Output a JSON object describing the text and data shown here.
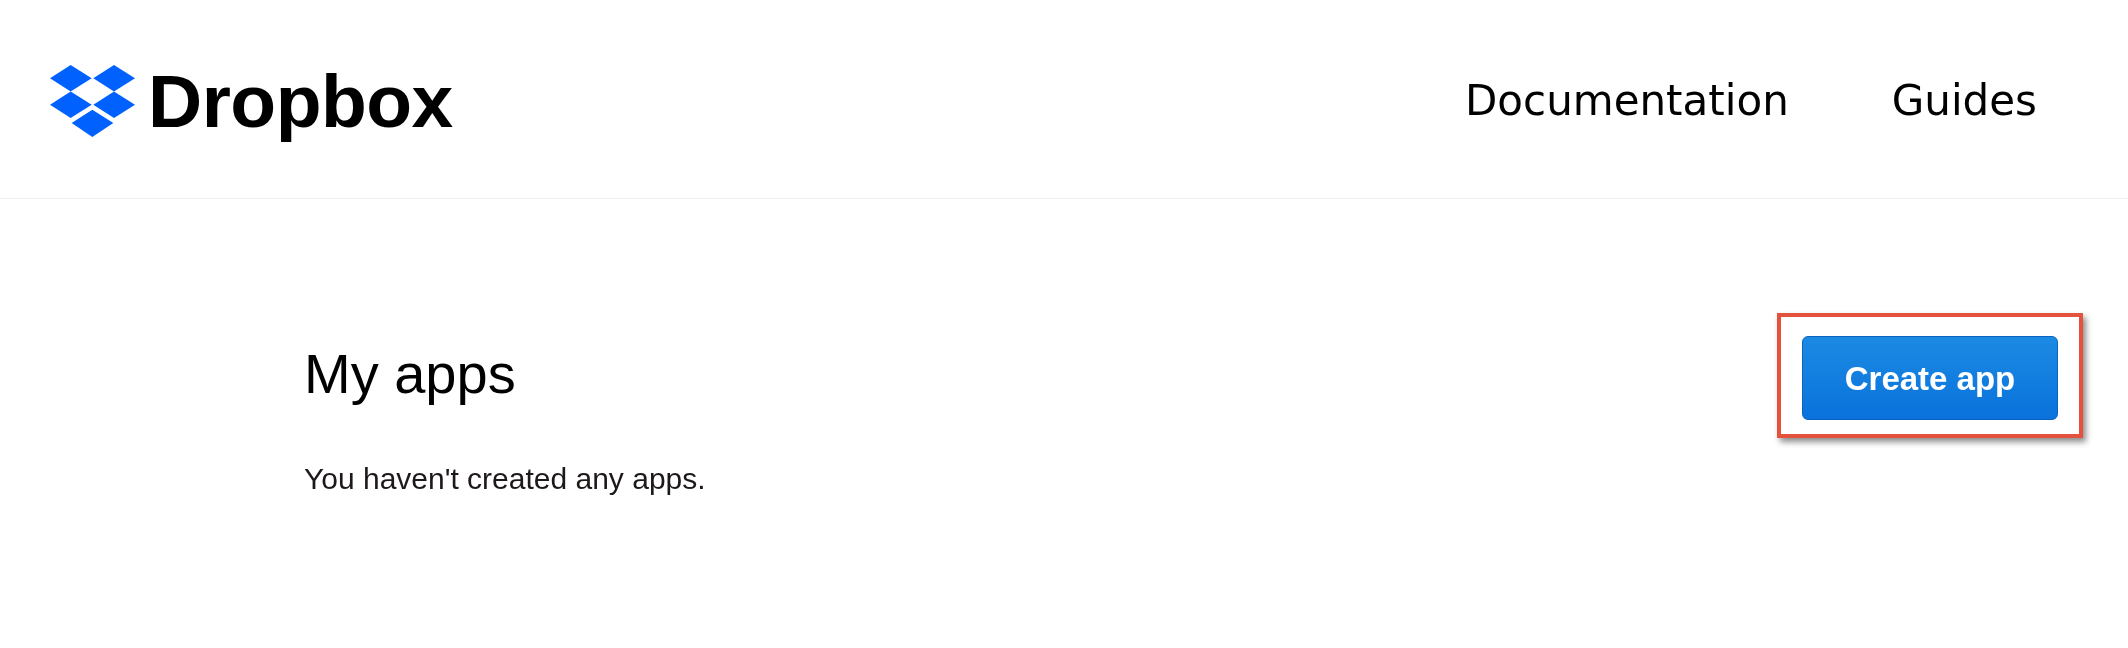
{
  "header": {
    "logo": {
      "text": "Dropbox"
    },
    "nav": [
      {
        "label": "Documentation"
      },
      {
        "label": "Guides"
      }
    ]
  },
  "main": {
    "title": "My apps",
    "empty_message": "You haven't created any apps.",
    "create_button": {
      "label": "Create app",
      "highlighted": true
    }
  }
}
